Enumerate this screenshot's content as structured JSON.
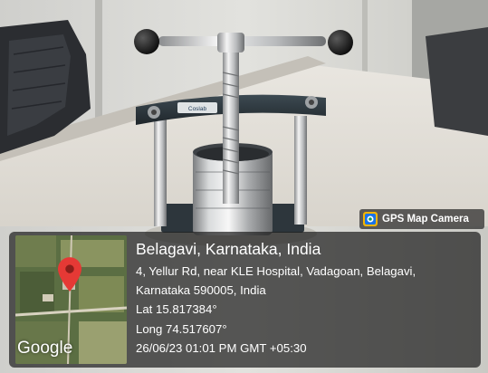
{
  "watermark": {
    "badge_label": "GPS Map Camera",
    "icon": "gps-map-camera-app-icon"
  },
  "map": {
    "brand": "Google",
    "marker_icon": "map-pin-icon",
    "marker_color": "#e53935"
  },
  "location": {
    "title": "Belagavi, Karnataka, India",
    "address_line1": "4, Yellur Rd, near KLE Hospital, Vadagoan, Belagavi,",
    "address_line2": "Karnataka 590005, India",
    "lat": "Lat 15.817384°",
    "long": "Long 74.517607°",
    "datetime": "26/06/23 01:01 PM GMT +05:30"
  },
  "product_label": "Coslab"
}
